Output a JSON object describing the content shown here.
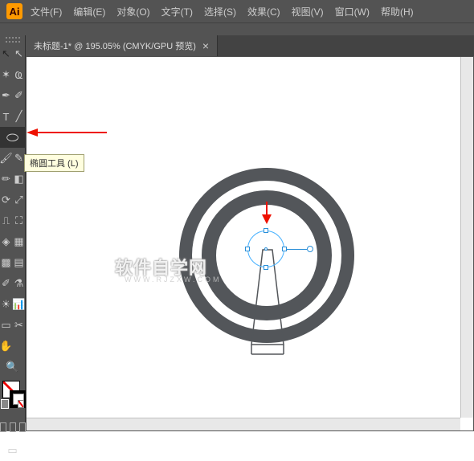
{
  "app": {
    "logo": "Ai"
  },
  "menu": {
    "items": [
      {
        "label": "文件(F)"
      },
      {
        "label": "编辑(E)"
      },
      {
        "label": "对象(O)"
      },
      {
        "label": "文字(T)"
      },
      {
        "label": "选择(S)"
      },
      {
        "label": "效果(C)"
      },
      {
        "label": "视图(V)"
      },
      {
        "label": "窗口(W)"
      },
      {
        "label": "帮助(H)"
      }
    ]
  },
  "tab": {
    "title": "未标题-1* @ 195.05% (CMYK/GPU 预览)",
    "close": "×"
  },
  "tooltip": {
    "text": "椭圆工具 (L)"
  },
  "tools": {
    "selection": "↖",
    "direct": "↖",
    "wand": "✶",
    "lasso": "Ҩ",
    "pen": "✒",
    "curve": "✐",
    "type": "T",
    "line": "╱",
    "ellipse": "⬭",
    "brush": "🖌",
    "pencil": "✎",
    "blob": "✏",
    "eraser": "◧",
    "rotate": "⟳",
    "scale": "⤢",
    "width": "⎍",
    "free": "⛶",
    "shaper": "◈",
    "perspective": "▦",
    "mesh": "▩",
    "gradient": "▤",
    "eyedrop": "✐",
    "blend": "⚗",
    "symbol": "☀",
    "graph": "📊",
    "artboard": "▭",
    "slice": "✂",
    "hand": "✋",
    "zoom": "🔍"
  },
  "watermark": {
    "main": "软件自学网",
    "sub": "WWW.RJZXW.COM"
  }
}
